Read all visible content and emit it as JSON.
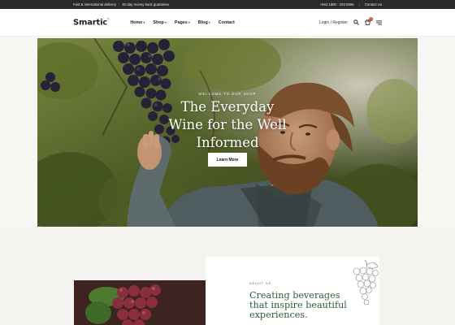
{
  "topbar": {
    "left": [
      "Fast & international delivery",
      "|",
      "30-day money back guarantee"
    ],
    "phone": "+844 1800 - 333 5555",
    "contact": "Contact Us"
  },
  "header": {
    "logo": "Smartic",
    "nav": [
      {
        "label": "Home"
      },
      {
        "label": "Shop"
      },
      {
        "label": "Pages"
      },
      {
        "label": "Blog"
      },
      {
        "label": "Contact"
      }
    ],
    "login": "Login / Register",
    "cart_count": "0",
    "icons": [
      "search-icon",
      "cart-icon",
      "menu-icon"
    ]
  },
  "hero": {
    "kicker": "WELCOME TO OUR SHOP",
    "title_lines": [
      "The Everyday",
      "Wine for the Well",
      "Informed"
    ],
    "button": "Learn More"
  },
  "about": {
    "kicker": "ABOUT US",
    "title_lines": [
      "Creating beverages",
      "that inspire beautiful",
      "experiences."
    ]
  },
  "colors": {
    "accent": "#c54a3c",
    "brand_green": "#2f5d3a",
    "topbar_bg": "#2a2a2a"
  }
}
